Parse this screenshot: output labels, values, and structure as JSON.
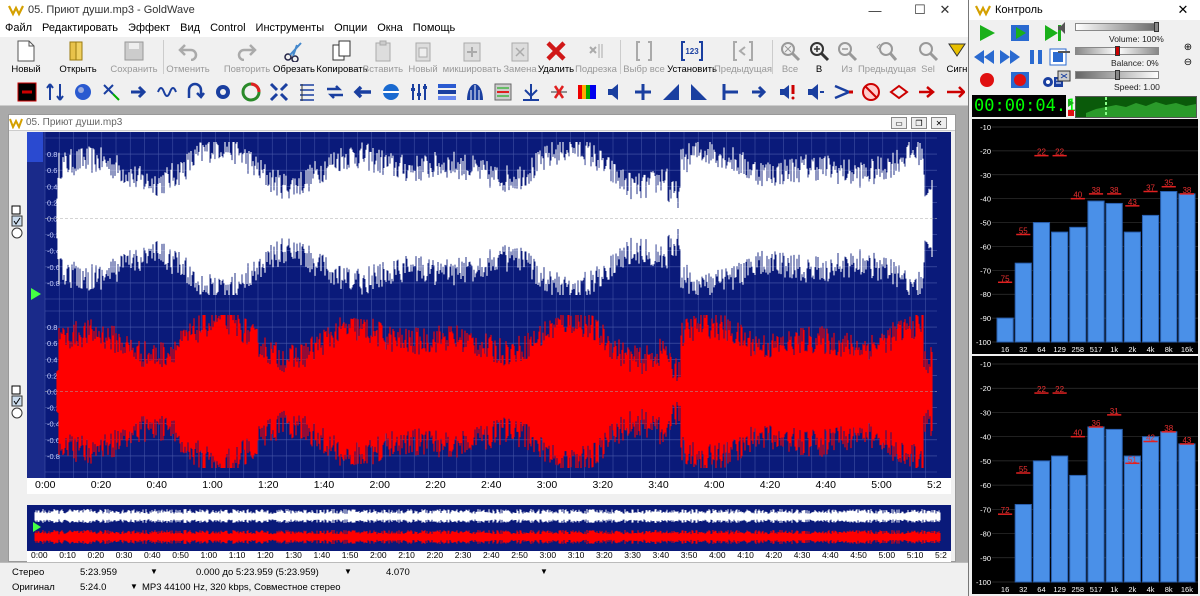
{
  "app": {
    "title": "05. Приют души.mp3 - GoldWave",
    "window_min": "—",
    "window_max": "☐",
    "window_close": "✕"
  },
  "menu": [
    "Файл",
    "Редактировать",
    "Эффект",
    "Вид",
    "Control",
    "Инструменты",
    "Опции",
    "Окна",
    "Помощь"
  ],
  "toolbar": {
    "new": "Новый",
    "open": "Открыть",
    "save": "Сохранить",
    "undo": "Отменить",
    "redo": "Повторить",
    "trim": "Обрезать",
    "copy": "Копировать",
    "paste": "Вставить",
    "paste_new": "Новый",
    "mix": "микшировать",
    "replace": "Замена",
    "delete": "Удалить",
    "trim_pad": "Подрезка",
    "select_all": "Выбр все",
    "set": "Установить",
    "previous": "Предыдущая",
    "all": "Все",
    "zoom_in": "В",
    "zoom_out": "Из",
    "prev_zoom": "Предыдущая",
    "sel": "Sel",
    "signal": "Сигн"
  },
  "document": {
    "title": "05. Приют души.mp3",
    "amp_ticks_top": [
      "0.8",
      "0.6",
      "0.4",
      "0.2",
      "0.0",
      "-0.2",
      "-0.4",
      "-0.6",
      "-0.8"
    ],
    "amp_ticks_bottom": [
      "0.8",
      "0.6",
      "0.4",
      "0.2",
      "0.0",
      "-0.2",
      "-0.4",
      "-0.6",
      "-0.8"
    ],
    "time_ticks": [
      "0:00",
      "0:20",
      "0:40",
      "1:00",
      "1:20",
      "1:40",
      "2:00",
      "2:20",
      "2:40",
      "3:00",
      "3:20",
      "3:40",
      "4:00",
      "4:20",
      "4:40",
      "5:00",
      "5:2"
    ],
    "overview_ticks": [
      "0:00",
      "0:10",
      "0:20",
      "0:30",
      "0:40",
      "0:50",
      "1:00",
      "1:10",
      "1:20",
      "1:30",
      "1:40",
      "1:50",
      "2:00",
      "2:10",
      "2:20",
      "2:30",
      "2:40",
      "2:50",
      "3:00",
      "3:10",
      "3:20",
      "3:30",
      "3:40",
      "3:50",
      "4:00",
      "4:10",
      "4:20",
      "4:30",
      "4:40",
      "4:50",
      "5:00",
      "5:10",
      "5:2"
    ],
    "colors": {
      "background": "#0a1a7a",
      "left_channel": "#ffffff",
      "right_channel": "#ff0000",
      "grid": "#4a5aaa"
    }
  },
  "status": {
    "channels": "Стерео",
    "length": "5:23.959",
    "selection": "0.000 до 5:23.959 (5:23.959)",
    "position": "4.070",
    "original_label": "Оригинал",
    "original_length": "5:24.0",
    "format": "MP3 44100 Hz, 320 kbps, Совместное стерео"
  },
  "control": {
    "title": "Контроль",
    "volume": "Volume: 100%",
    "volume_level": 1.0,
    "balance": "Balance: 0%",
    "balance_level": 0.0,
    "speed": "Speed: 1.00",
    "speed_level": 1.0,
    "timer": "00:00:04.1",
    "db_ticks": [
      "-10",
      "-20",
      "-30",
      "-40",
      "-50",
      "-60",
      "-70",
      "-80",
      "-90",
      "-100"
    ],
    "freq_ticks": [
      "16",
      "32",
      "64",
      "129",
      "258",
      "517",
      "1k",
      "2k",
      "4k",
      "8k",
      "16k"
    ],
    "spectrum_top": [
      -90,
      -67,
      -50,
      -54,
      -52,
      -41,
      -42,
      -54,
      -47,
      -37,
      -38
    ],
    "peaks_top": [
      "75",
      "55",
      "22",
      "22",
      "40",
      "38",
      "38",
      "43",
      "37",
      "35",
      "38"
    ],
    "spectrum_bottom": [
      -100,
      -68,
      -50,
      -48,
      -56,
      -36,
      -37,
      -48,
      -40,
      -38,
      -43
    ],
    "peaks_bottom": [
      "72",
      "55",
      "22",
      "22",
      "40",
      "36",
      "31",
      "51",
      "42",
      "38",
      "43"
    ]
  }
}
